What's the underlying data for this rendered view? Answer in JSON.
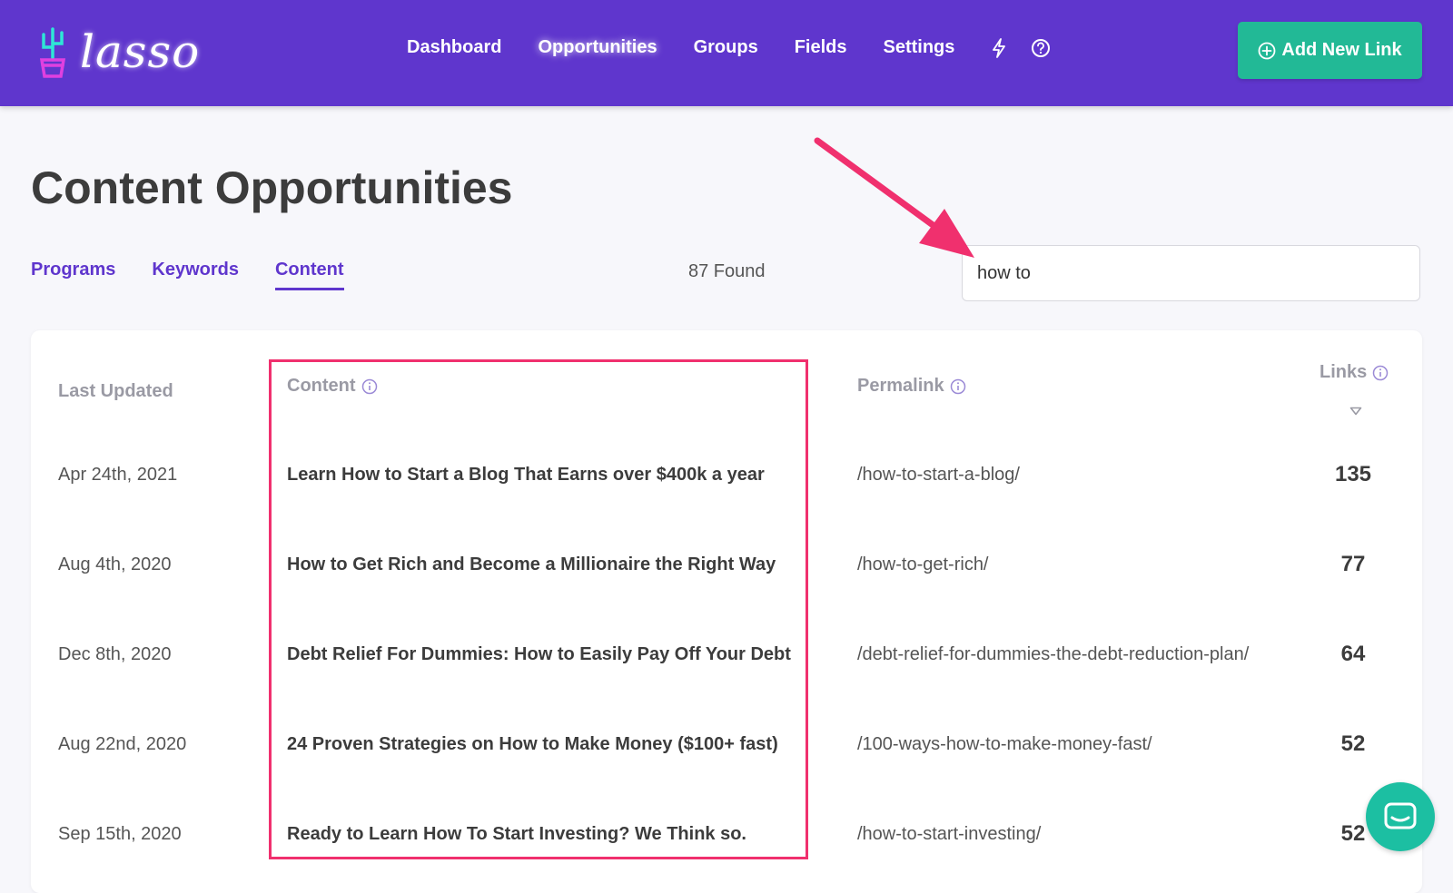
{
  "app": {
    "logo_text": "lasso"
  },
  "nav": {
    "items": [
      {
        "label": "Dashboard"
      },
      {
        "label": "Opportunities",
        "active": true
      },
      {
        "label": "Groups"
      },
      {
        "label": "Fields"
      },
      {
        "label": "Settings"
      }
    ],
    "icons": [
      "lightning-icon",
      "help-icon"
    ]
  },
  "actions": {
    "add_new_link_label": "Add New Link"
  },
  "page": {
    "title": "Content Opportunities"
  },
  "tabs": [
    {
      "label": "Programs"
    },
    {
      "label": "Keywords"
    },
    {
      "label": "Content",
      "active": true
    }
  ],
  "results": {
    "found_text": "87 Found"
  },
  "search": {
    "value": "how to"
  },
  "table": {
    "headers": {
      "last_updated": "Last Updated",
      "content": "Content",
      "permalink": "Permalink",
      "links": "Links"
    },
    "rows": [
      {
        "date": "Apr 24th, 2021",
        "title": "Learn How to Start a Blog That Earns over $400k a year",
        "permalink": "/how-to-start-a-blog/",
        "links": "135"
      },
      {
        "date": "Aug 4th, 2020",
        "title": "How to Get Rich and Become a Millionaire the Right Way",
        "permalink": "/how-to-get-rich/",
        "links": "77"
      },
      {
        "date": "Dec 8th, 2020",
        "title": "Debt Relief For Dummies: How to Easily Pay Off Your Debt",
        "permalink": "/debt-relief-for-dummies-the-debt-reduction-plan/",
        "links": "64"
      },
      {
        "date": "Aug 22nd, 2020",
        "title": "24 Proven Strategies on How to Make Money ($100+ fast)",
        "permalink": "/100-ways-how-to-make-money-fast/",
        "links": "52"
      },
      {
        "date": "Sep 15th, 2020",
        "title": "Ready to Learn How To Start Investing? We Think so.",
        "permalink": "/how-to-start-investing/",
        "links": "52"
      }
    ]
  },
  "colors": {
    "header_bg": "#5f36cd",
    "accent": "#5f36cd",
    "add_button": "#22b996",
    "highlight": "#f0306e",
    "chat_bubble": "#1cbfa2"
  }
}
